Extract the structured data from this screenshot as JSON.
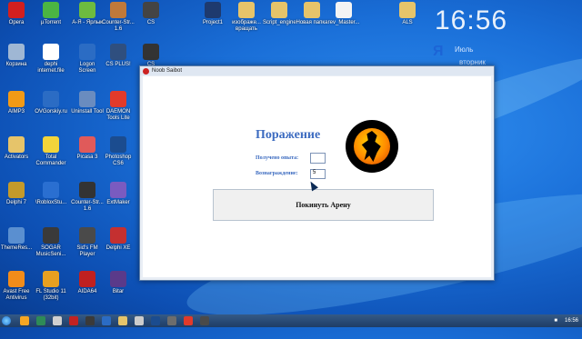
{
  "desktop": {
    "icons": [
      {
        "label": "Opera",
        "color": "#d21f1f"
      },
      {
        "label": "µTorrent",
        "color": "#4bb543"
      },
      {
        "label": "А-Я - Ярлык",
        "color": "#6dbb3f"
      },
      {
        "label": "Counter-Str... 1.6",
        "color": "#c0793a"
      },
      {
        "label": "CS",
        "color": "#444444"
      },
      {
        "label": "Project1",
        "color": "#1e3a6e"
      },
      {
        "label": "изображе... вращать",
        "color": "#e6c46a"
      },
      {
        "label": "Script_engine",
        "color": "#e6c46a"
      },
      {
        "label": "Новая папка",
        "color": "#e6c46a"
      },
      {
        "label": "rev_Master...",
        "color": "#f4f4f4"
      },
      {
        "label": "ALS",
        "color": "#e6c46a"
      },
      {
        "label": "Корзина",
        "color": "#9fb7d4"
      },
      {
        "label": "dephi internet.file",
        "color": "#ffffff"
      },
      {
        "label": "Logon Screen",
        "color": "#2b6cc4"
      },
      {
        "label": "CS PLUS!",
        "color": "#2f4f7f"
      },
      {
        "label": "CS",
        "color": "#333333"
      },
      {
        "label": "AIMP3",
        "color": "#f29a16"
      },
      {
        "label": "OVGorskiy.ru",
        "color": "#2b6cc4"
      },
      {
        "label": "Uninstall Tool",
        "color": "#6a8cbf"
      },
      {
        "label": "DAEMON Tools Lite",
        "color": "#e23a2a"
      },
      {
        "label": "Activators",
        "color": "#e6c46a"
      },
      {
        "label": "Total Commander",
        "color": "#f2d43a"
      },
      {
        "label": "Picasa 3",
        "color": "#e05a5a"
      },
      {
        "label": "Photoshop CS6",
        "color": "#1b4c8f"
      },
      {
        "label": "Delphi 7",
        "color": "#c49a2a"
      },
      {
        "label": "\\RobloxStu...",
        "color": "#2a6fd1"
      },
      {
        "label": "Counter-Str... 1.6",
        "color": "#333333"
      },
      {
        "label": "ExtMaker",
        "color": "#7a5bc0"
      },
      {
        "label": "ThemeRes...",
        "color": "#5a8fd0"
      },
      {
        "label": "SOGAR MusicSeni...",
        "color": "#3a3a3a"
      },
      {
        "label": "Sid's FM Player",
        "color": "#4a4a4a"
      },
      {
        "label": "Delphi XE",
        "color": "#c43030"
      },
      {
        "label": "Avast Free Antivirus",
        "color": "#f28c1a"
      },
      {
        "label": "FL Studio 11 (32bit)",
        "color": "#e8a020"
      },
      {
        "label": "AIDA64",
        "color": "#c02020"
      },
      {
        "label": "Bitar",
        "color": "#5a3a8a"
      }
    ],
    "clock_widget": {
      "time": "16:56",
      "brand": "Я",
      "line1": "Июль",
      "line2": "вторник"
    }
  },
  "window": {
    "title": "Noob Saibot",
    "heading": "Поражение",
    "exp_label": "Получено опыта:",
    "exp_value": "",
    "reward_label": "Вознаграждение:",
    "reward_value": "5",
    "leave_button": "Покинуть Арену"
  },
  "taskbar": {
    "apps": [
      "#f5a623",
      "#2e8b57",
      "#d0d0d0",
      "#c22222",
      "#3a3a3a",
      "#2b6cc4",
      "#e6c46a",
      "#cccccc",
      "#1b4c8f",
      "#6d6d6d",
      "#e23a2a",
      "#4a4a4a"
    ],
    "time": "16:56"
  }
}
